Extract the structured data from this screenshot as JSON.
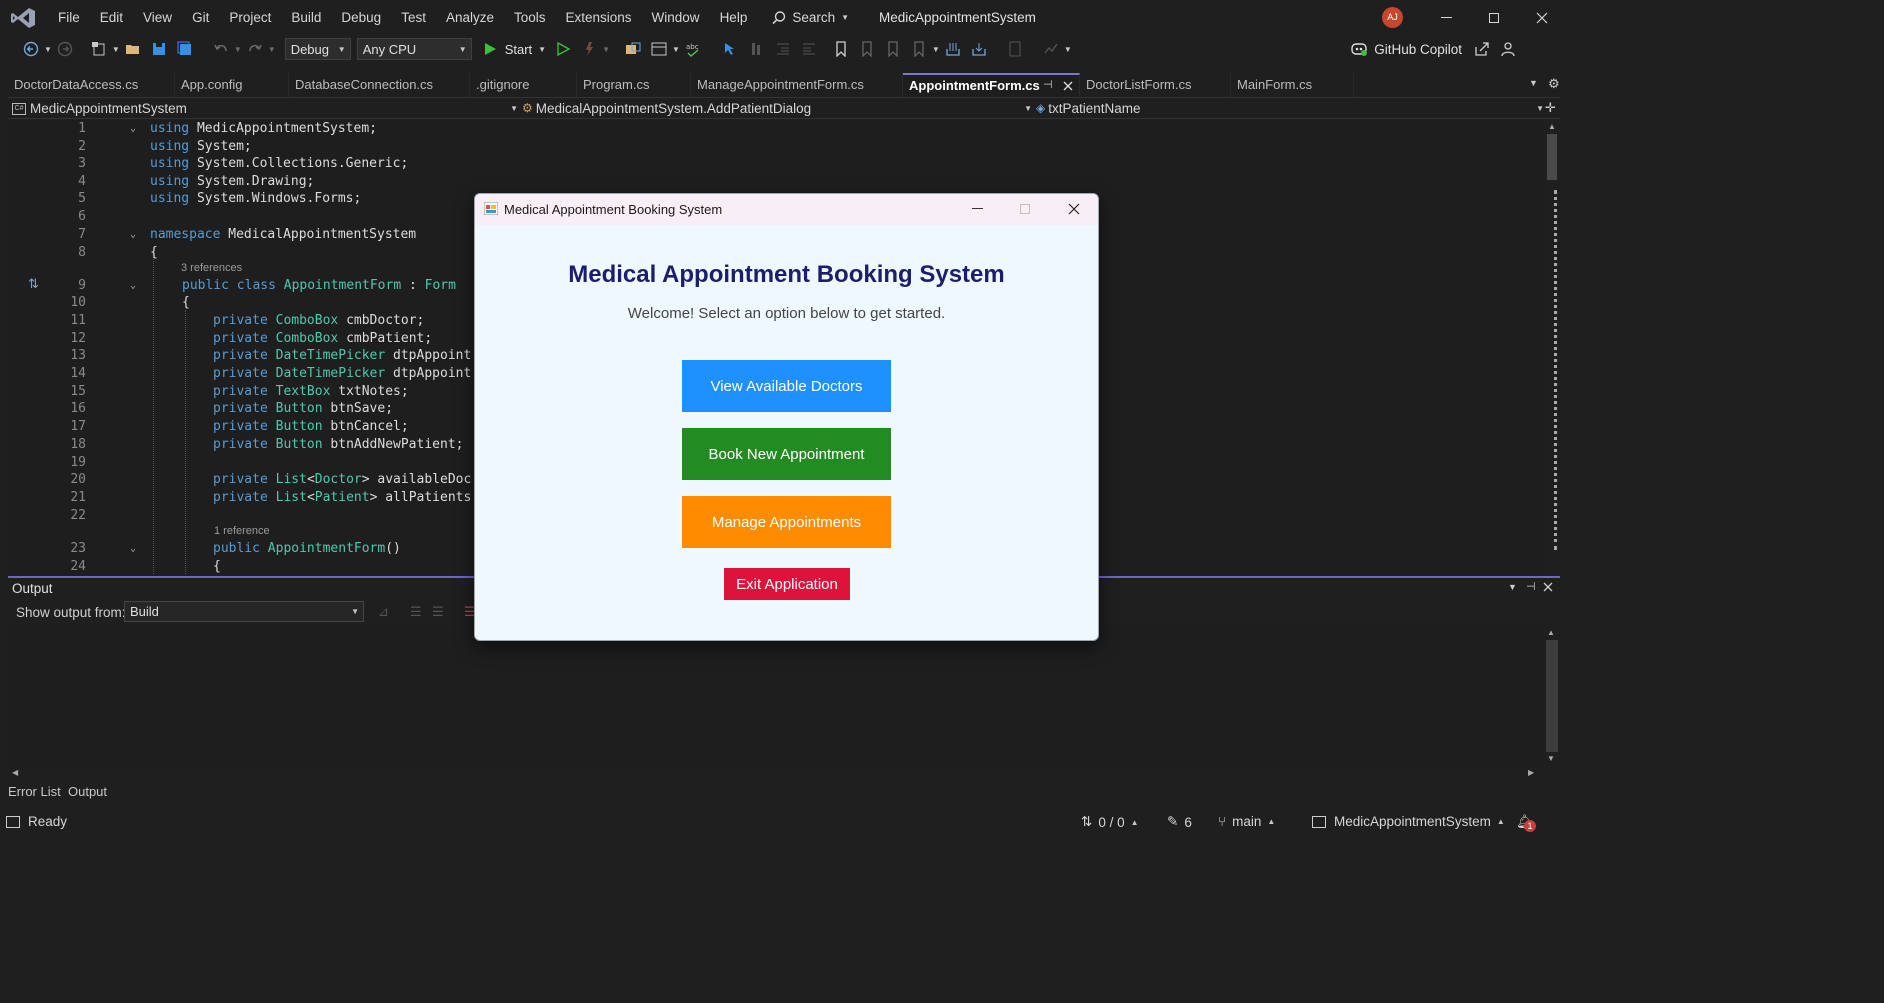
{
  "app": {
    "menu": [
      "File",
      "Edit",
      "View",
      "Git",
      "Project",
      "Build",
      "Debug",
      "Test",
      "Analyze",
      "Tools",
      "Extensions",
      "Window",
      "Help"
    ],
    "search_label": "Search",
    "title": "MedicAppointmentSystem",
    "avatar_initials": "AJ"
  },
  "toolbar": {
    "config": "Debug",
    "platform": "Any CPU",
    "start_label": "Start",
    "copilot_label": "GitHub Copilot"
  },
  "tabs": [
    {
      "label": "DoctorDataAccess.cs",
      "active": false
    },
    {
      "label": "App.config",
      "active": false
    },
    {
      "label": "DatabaseConnection.cs",
      "active": false
    },
    {
      "label": ".gitignore",
      "active": false
    },
    {
      "label": "Program.cs",
      "active": false
    },
    {
      "label": "ManageAppointmentForm.cs",
      "active": false
    },
    {
      "label": "AppointmentForm.cs",
      "active": true
    },
    {
      "label": "DoctorListForm.cs",
      "active": false
    },
    {
      "label": "MainForm.cs",
      "active": false
    }
  ],
  "navbar": {
    "project": "MedicAppointmentSystem",
    "type": "MedicalAppointmentSystem.AddPatientDialog",
    "member": "txtPatientName"
  },
  "code": {
    "lines": [
      {
        "n": "1",
        "text": "using MedicAppointmentSystem;"
      },
      {
        "n": "2",
        "text": "using System;"
      },
      {
        "n": "3",
        "text": "using System.Collections.Generic;"
      },
      {
        "n": "4",
        "text": "using System.Drawing;"
      },
      {
        "n": "5",
        "text": "using System.Windows.Forms;"
      },
      {
        "n": "6",
        "text": ""
      },
      {
        "n": "7",
        "text": "namespace MedicalAppointmentSystem"
      },
      {
        "n": "8",
        "text": "{"
      },
      {
        "n": "9",
        "text": "public class AppointmentForm : Form"
      },
      {
        "n": "10",
        "text": "{"
      },
      {
        "n": "11",
        "text": "private ComboBox cmbDoctor;"
      },
      {
        "n": "12",
        "text": "private ComboBox cmbPatient;"
      },
      {
        "n": "13",
        "text": "private DateTimePicker dtpAppoint"
      },
      {
        "n": "14",
        "text": "private DateTimePicker dtpAppoint"
      },
      {
        "n": "15",
        "text": "private TextBox txtNotes;"
      },
      {
        "n": "16",
        "text": "private Button btnSave;"
      },
      {
        "n": "17",
        "text": "private Button btnCancel;"
      },
      {
        "n": "18",
        "text": "private Button btnAddNewPatient;"
      },
      {
        "n": "19",
        "text": ""
      },
      {
        "n": "20",
        "text": "private List<Doctor> availableDoc"
      },
      {
        "n": "21",
        "text": "private List<Patient> allPatients"
      },
      {
        "n": "22",
        "text": ""
      },
      {
        "n": "23",
        "text": "public AppointmentForm()"
      },
      {
        "n": "24",
        "text": "{"
      }
    ],
    "ref_3": "3 references",
    "ref_1": "1 reference"
  },
  "output": {
    "title": "Output",
    "show_from_label": "Show output from:",
    "source": "Build"
  },
  "bottom_tabs": [
    "Error List",
    "Output"
  ],
  "status": {
    "ready": "Ready",
    "changes": "0 / 0",
    "pending": "6",
    "branch": "main",
    "repo": "MedicAppointmentSystem",
    "notifications": "1"
  },
  "dialog": {
    "window_title": "Medical Appointment Booking System",
    "heading": "Medical Appointment Booking System",
    "subtitle": "Welcome! Select an option below to get started.",
    "buttons": {
      "view_doctors": "View Available Doctors",
      "book": "Book New Appointment",
      "manage": "Manage Appointments",
      "exit": "Exit Application"
    },
    "colors": {
      "view_doctors": "#1e90ff",
      "book": "#228b22",
      "manage": "#ff8c00",
      "exit": "#dc143c"
    }
  }
}
